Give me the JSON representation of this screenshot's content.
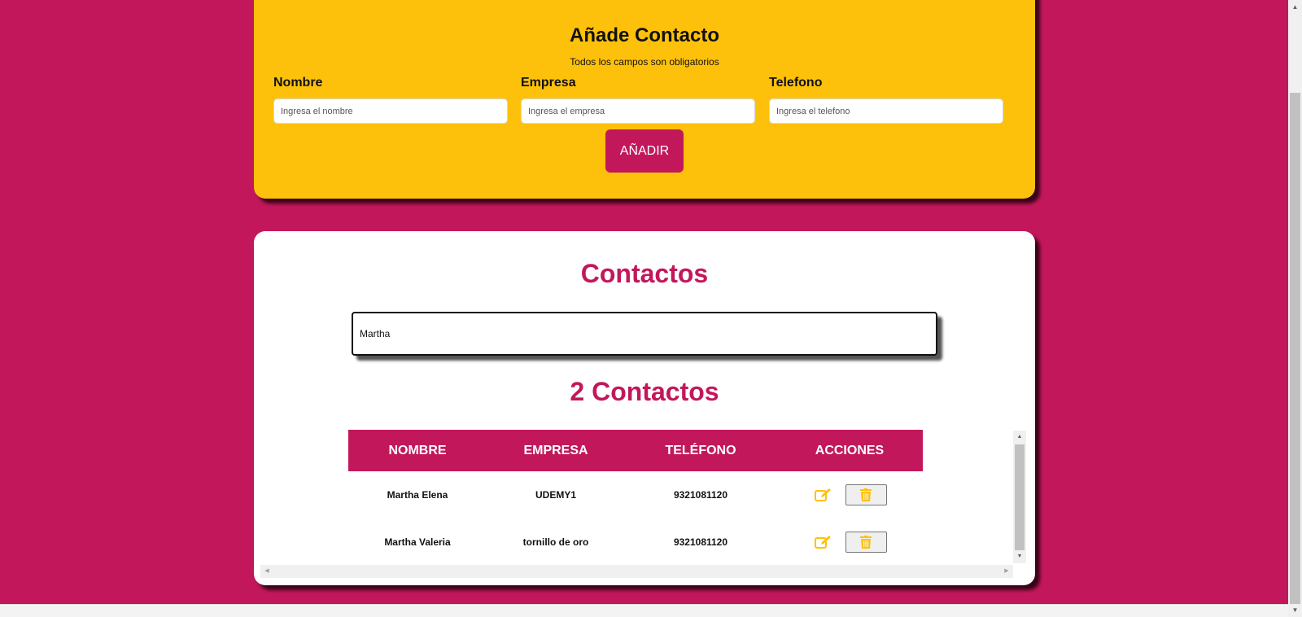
{
  "form": {
    "title": "Añade Contacto",
    "subtitle": "Todos los campos son obligatorios",
    "fields": [
      {
        "label": "Nombre",
        "placeholder": "Ingresa el nombre",
        "value": ""
      },
      {
        "label": "Empresa",
        "placeholder": "Ingresa el empresa",
        "value": ""
      },
      {
        "label": "Telefono",
        "placeholder": "Ingresa el telefono",
        "value": ""
      }
    ],
    "submit_label": "AÑADIR"
  },
  "contacts": {
    "title": "Contactos",
    "search_value": "Martha",
    "count_text": "2 Contactos",
    "columns": [
      "NOMBRE",
      "EMPRESA",
      "TELÉFONO",
      "ACCIONES"
    ],
    "rows": [
      {
        "nombre": "Martha Elena",
        "empresa": "UDEMY1",
        "telefono": "9321081120"
      },
      {
        "nombre": "Martha Valeria",
        "empresa": "tornillo de oro",
        "telefono": "9321081120"
      }
    ]
  },
  "icons": {
    "edit": "edit-icon",
    "delete": "trash-icon"
  },
  "colors": {
    "background": "#c2185b",
    "form_card": "#fec10b",
    "accent": "#c2185b",
    "icon": "#fec10b"
  }
}
